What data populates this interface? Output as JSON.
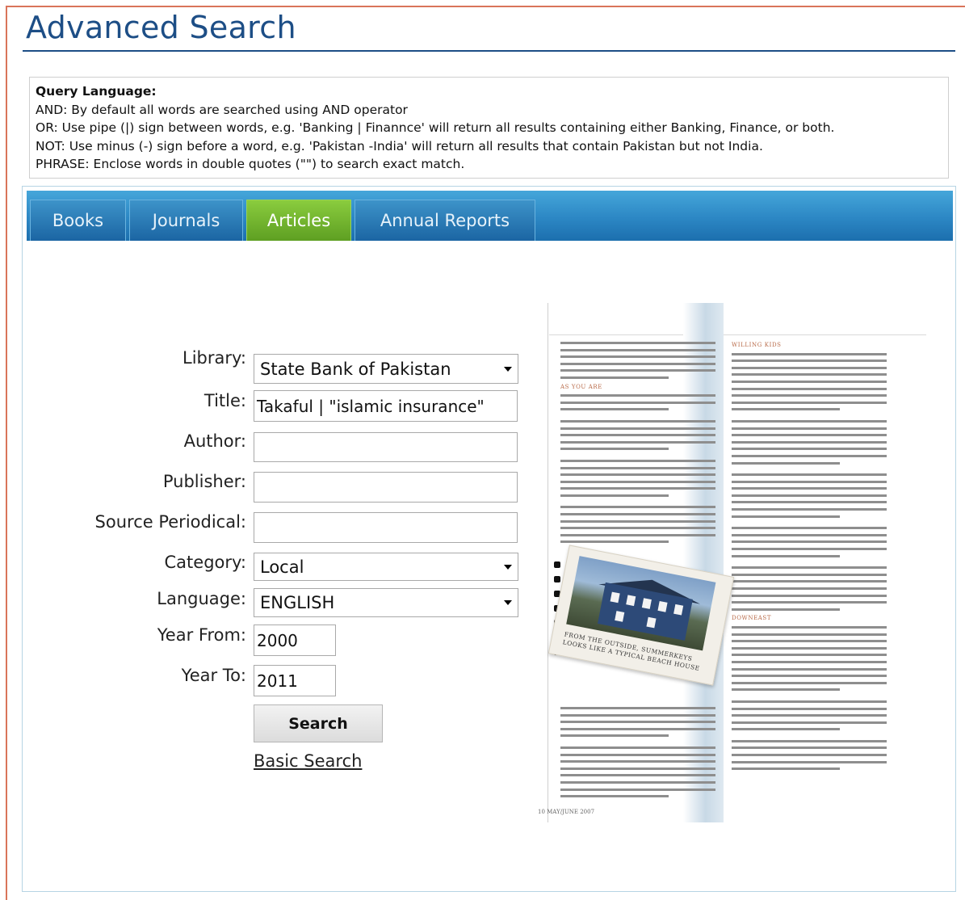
{
  "page": {
    "title": "Advanced Search"
  },
  "query_help": {
    "heading": "Query Language:",
    "lines": [
      "AND: By default all words are searched using AND operator",
      "OR: Use pipe (|) sign between words, e.g. 'Banking | Finannce' will return all results containing either Banking, Finance, or both.",
      "NOT: Use minus (-) sign before a word, e.g. 'Pakistan -India' will return all results that contain Pakistan but not India.",
      "PHRASE: Enclose words in double quotes (\"\") to search exact match."
    ]
  },
  "tabs": [
    {
      "label": "Books",
      "active": false
    },
    {
      "label": "Journals",
      "active": false
    },
    {
      "label": "Articles",
      "active": true
    },
    {
      "label": "Annual Reports",
      "active": false
    }
  ],
  "form": {
    "library": {
      "label": "Library:",
      "value": "State Bank of Pakistan"
    },
    "title": {
      "label": "Title:",
      "value": "Takaful | \"islamic insurance\""
    },
    "author": {
      "label": "Author:",
      "value": ""
    },
    "publisher": {
      "label": "Publisher:",
      "value": ""
    },
    "source_periodical": {
      "label": "Source Periodical:",
      "value": ""
    },
    "category": {
      "label": "Category:",
      "value": "Local"
    },
    "language": {
      "label": "Language:",
      "value": "ENGLISH"
    },
    "year_from": {
      "label": "Year From:",
      "value": "2000"
    },
    "year_to": {
      "label": "Year To:",
      "value": "2011"
    },
    "search_button": "Search",
    "basic_search_link": "Basic Search"
  },
  "magazine": {
    "left_subhead": "AS YOU ARE",
    "right_subhead_1": "WILLING KIDS",
    "right_subhead_2": "DOWNEAST",
    "photo_caption": "FROM THE OUTSIDE, SUMMERKEYS LOOKS LIKE A TYPICAL BEACH HOUSE",
    "footer": "10 MAY/JUNE 2007"
  },
  "colors": {
    "title_blue": "#1d4e86",
    "tab_bar_blue": "#2c87c4",
    "active_tab_green": "#6aab2a",
    "outer_border": "#d9745a"
  }
}
